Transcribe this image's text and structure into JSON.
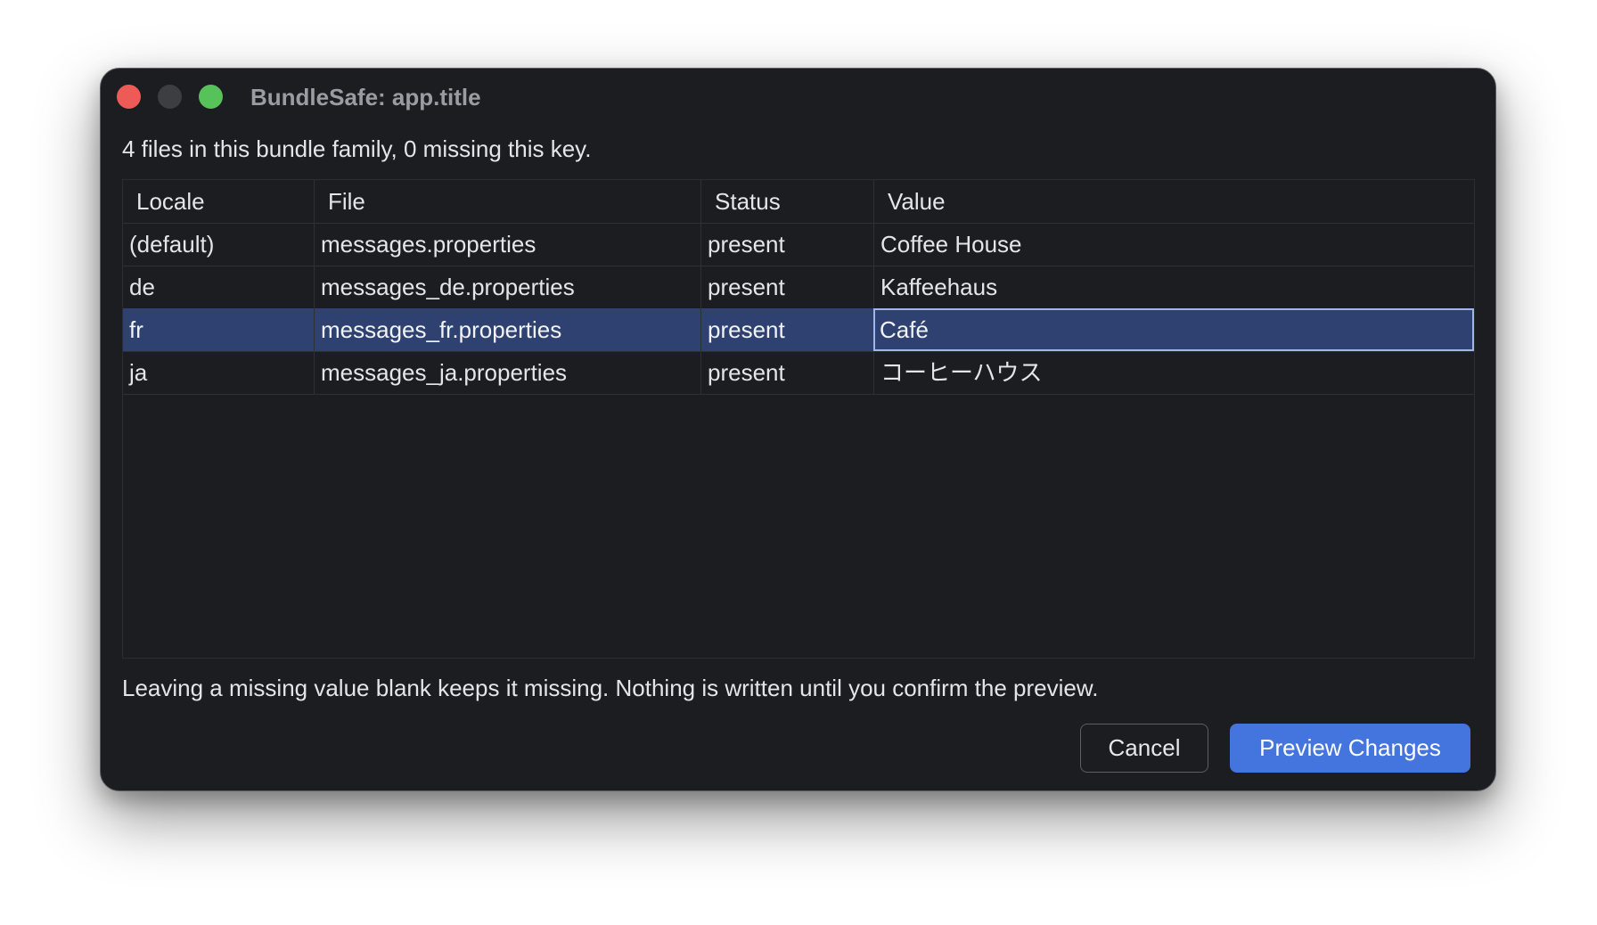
{
  "window": {
    "title": "BundleSafe: app.title"
  },
  "summary": "4 files in this bundle family, 0 missing this key.",
  "table": {
    "columns": [
      "Locale",
      "File",
      "Status",
      "Value"
    ],
    "rows": [
      {
        "locale": "(default)",
        "file": "messages.properties",
        "status": "present",
        "value": "Coffee House"
      },
      {
        "locale": "de",
        "file": "messages_de.properties",
        "status": "present",
        "value": "Kaffeehaus"
      },
      {
        "locale": "fr",
        "file": "messages_fr.properties",
        "status": "present",
        "value": "Café"
      },
      {
        "locale": "ja",
        "file": "messages_ja.properties",
        "status": "present",
        "value": "コーヒーハウス"
      }
    ],
    "selected_row": 2
  },
  "footnote": "Leaving a missing value blank keeps it missing. Nothing is written until you confirm the preview.",
  "buttons": {
    "cancel": "Cancel",
    "preview": "Preview Changes"
  },
  "colors": {
    "window_bg": "#1c1d20",
    "selection": "#2f4170",
    "primary": "#4474de",
    "close": "#ee5b57",
    "zoom": "#58c25a"
  }
}
